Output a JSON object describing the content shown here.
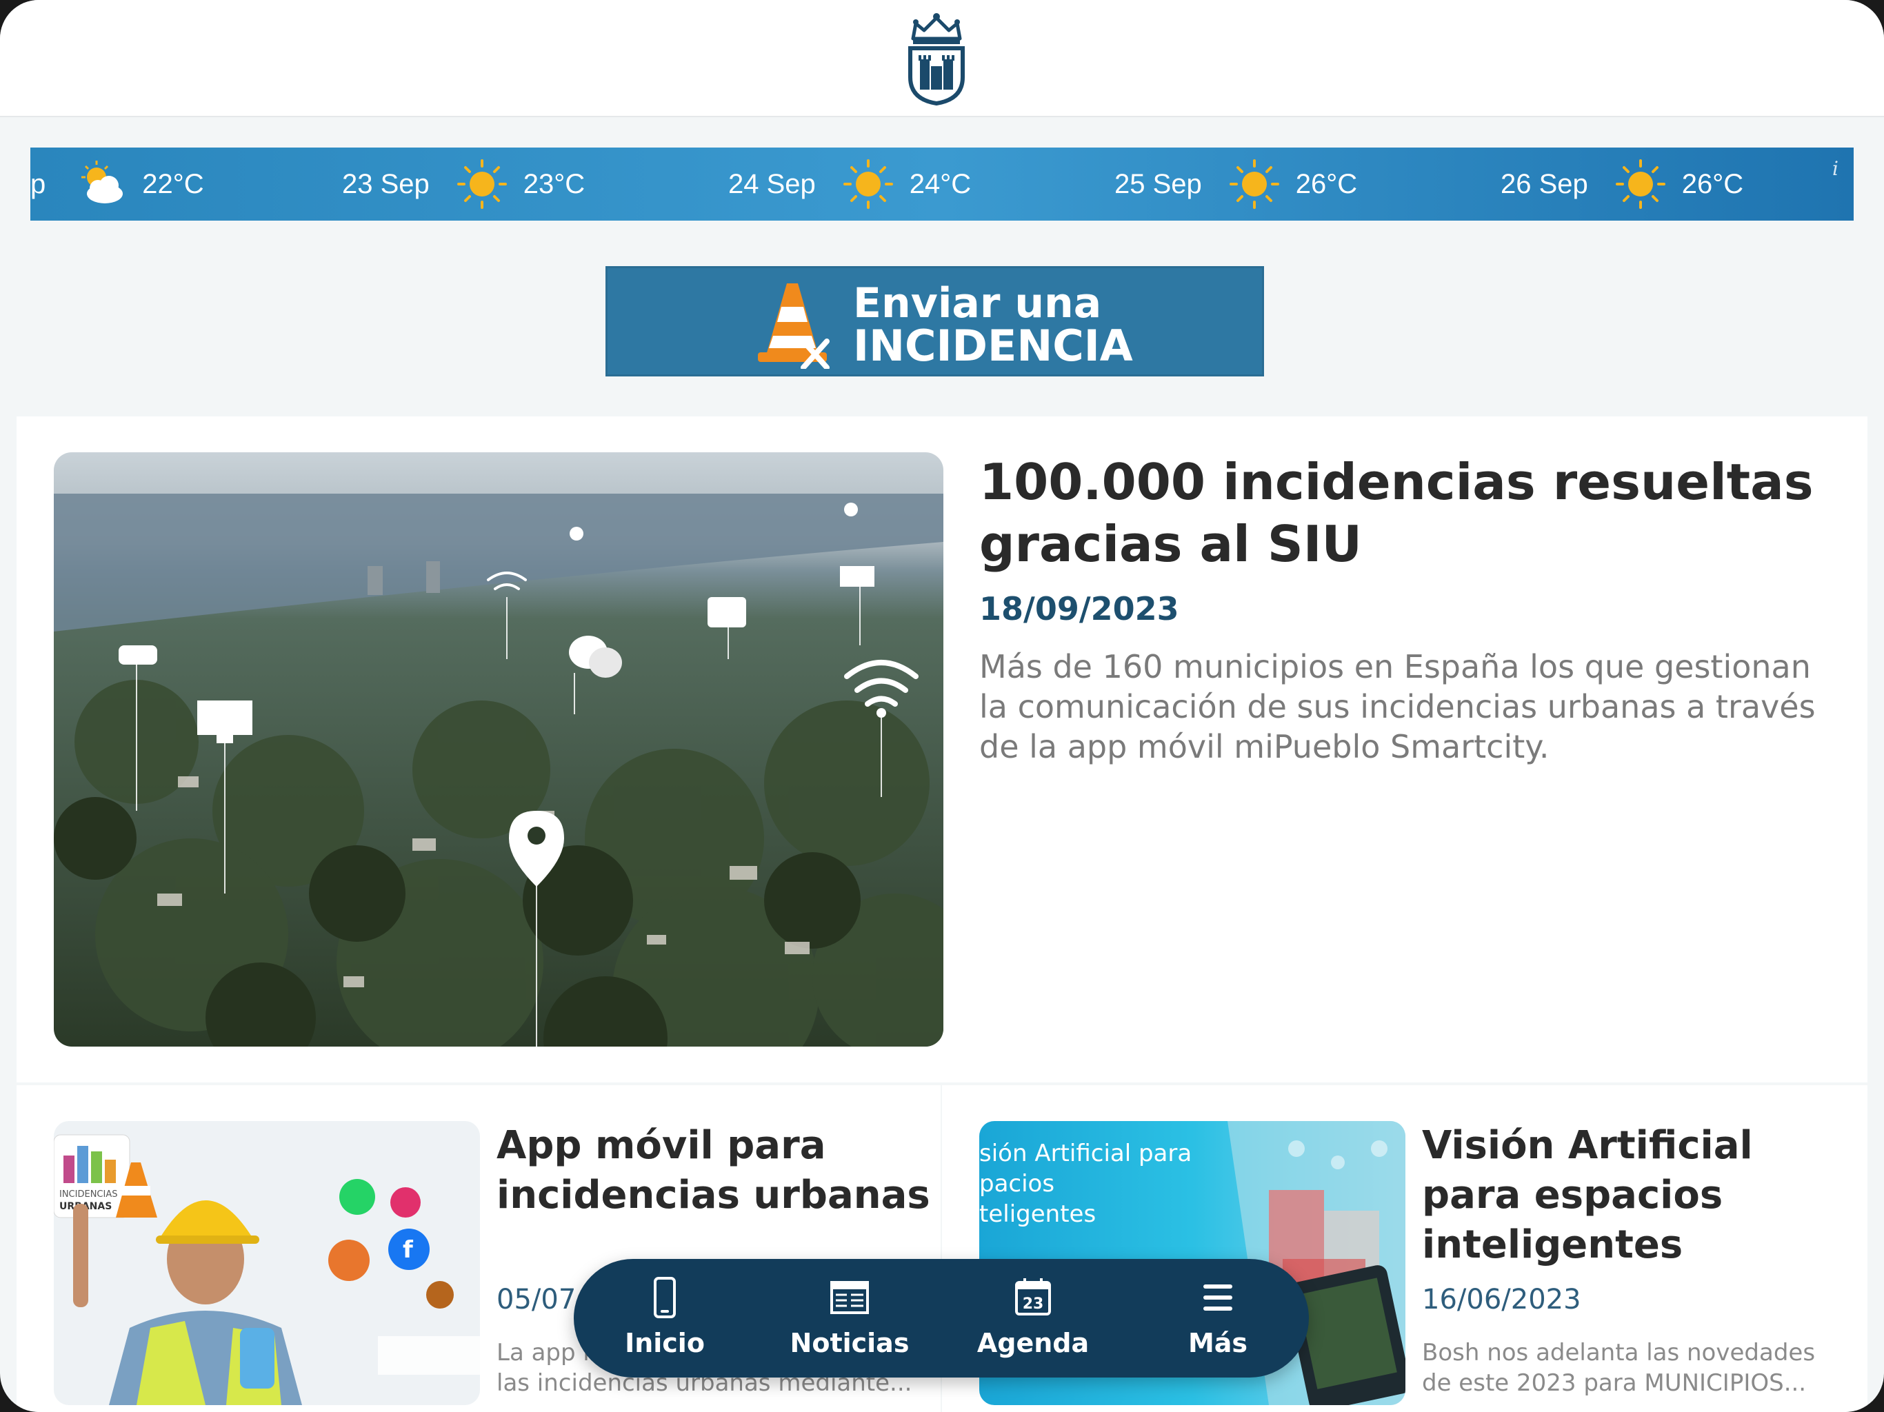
{
  "header": {
    "logo_icon": "city-crest-icon"
  },
  "weather": {
    "info_label": "i",
    "items": [
      {
        "date": "p",
        "temp": "22°C",
        "icon": "partly-cloudy-icon"
      },
      {
        "date": "23 Sep",
        "temp": "23°C",
        "icon": "sun-icon"
      },
      {
        "date": "24 Sep",
        "temp": "24°C",
        "icon": "sun-icon"
      },
      {
        "date": "25 Sep",
        "temp": "26°C",
        "icon": "sun-icon"
      },
      {
        "date": "26 Sep",
        "temp": "26°C",
        "icon": "sun-icon"
      }
    ]
  },
  "incidence_button": {
    "line1": "Enviar una",
    "line2": "INCIDENCIA",
    "icon": "traffic-cone-icon"
  },
  "featured": {
    "title": "100.000 incidencias resueltas gracias al SIU",
    "date": "18/09/2023",
    "description": "Más de 160 municipios en España los que gestionan la comunicación de sus incidencias urbanas a través de la app móvil miPueblo Smartcity."
  },
  "cards": [
    {
      "title": "App móvil para incidencias urbanas",
      "date": "05/07/2023",
      "description": "La app miPueblo permite gestionar las incidencias urbanas mediante...",
      "image_text": "INCIDENCIAS URBANAS"
    },
    {
      "title": "Visión Artificial para espacios inteligentes",
      "date": "16/06/2023",
      "description": "Bosh nos adelanta las novedades de este 2023 para MUNICIPIOS...",
      "image_text": "sión Artificial para\npacios\nteligentes"
    }
  ],
  "bottom_nav": [
    {
      "label": "Inicio",
      "icon": "phone-icon"
    },
    {
      "label": "Noticias",
      "icon": "newspaper-icon"
    },
    {
      "label": "Agenda",
      "icon": "calendar-icon",
      "day": "23"
    },
    {
      "label": "Más",
      "icon": "menu-icon"
    }
  ],
  "colors": {
    "header_bg": "#ffffff",
    "page_bg": "#f3f6f7",
    "weather_bg": "#2f8ec6",
    "button_bg": "#2e78a3",
    "nav_bg": "#123c5a",
    "title_text": "#2a2a2a",
    "date_text": "#1d4f6e"
  }
}
